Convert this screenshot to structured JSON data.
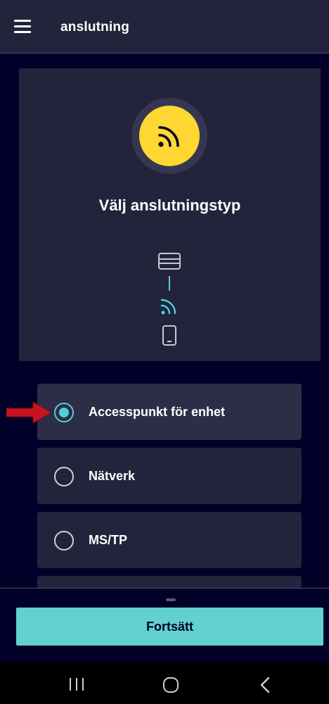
{
  "header": {
    "title": "anslutning",
    "menu_icon": "hamburger-menu-icon"
  },
  "hero": {
    "badge_icon": "wifi-signal-icon",
    "title": "Välj anslutningstyp",
    "diagram_icons": [
      "device-icon",
      "wifi-icon",
      "smartphone-icon"
    ],
    "badge_color": "#ffd732",
    "accent_color": "#4fd0d6"
  },
  "options": [
    {
      "label": "Accesspunkt för enhet",
      "selected": true
    },
    {
      "label": "Nätverk",
      "selected": false
    },
    {
      "label": "MS/TP",
      "selected": false
    }
  ],
  "footer": {
    "continue_label": "Fortsätt",
    "button_color": "#62cfd0"
  },
  "system_nav": {
    "icons": [
      "recent-apps-icon",
      "home-icon",
      "back-icon"
    ]
  }
}
